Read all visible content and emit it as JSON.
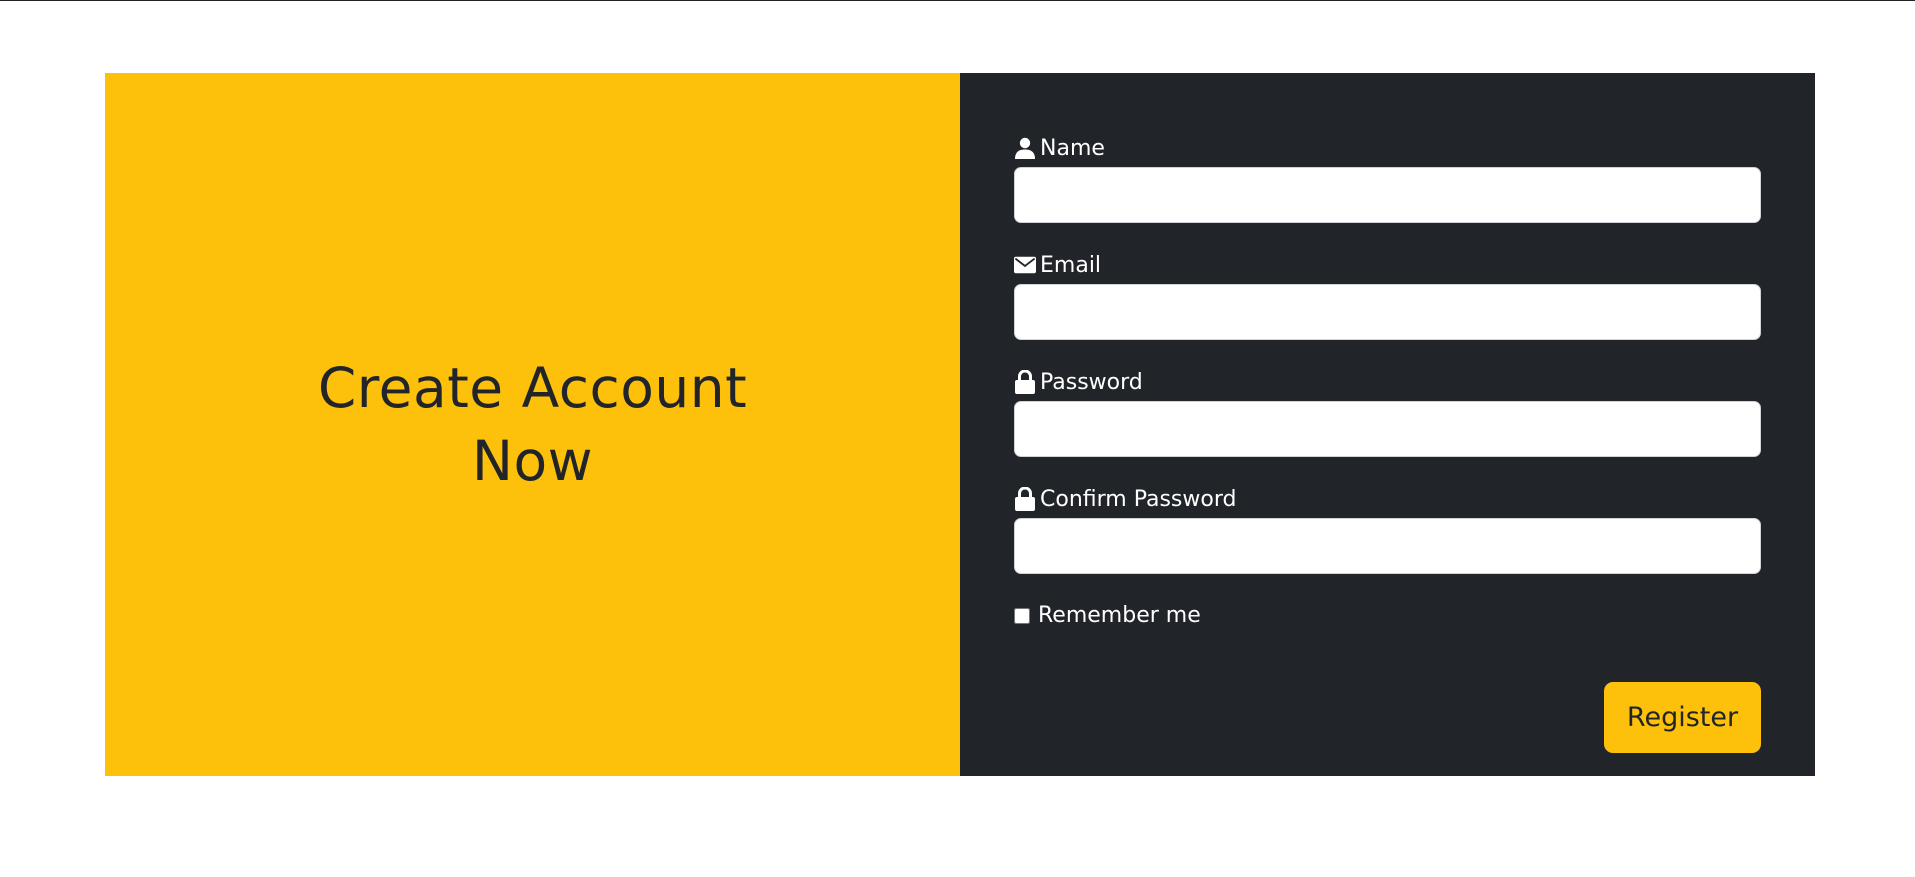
{
  "hero": {
    "title": "Create Account Now"
  },
  "form": {
    "fields": [
      {
        "label": "Name",
        "icon": "user-icon",
        "value": "",
        "placeholder": ""
      },
      {
        "label": "Email",
        "icon": "envelope-icon",
        "value": "",
        "placeholder": ""
      },
      {
        "label": "Password",
        "icon": "lock-icon",
        "value": "",
        "placeholder": ""
      },
      {
        "label": "Confirm Password",
        "icon": "lock-icon",
        "value": "",
        "placeholder": ""
      }
    ],
    "remember_label": "Remember me",
    "remember_checked": false,
    "submit_label": "Register"
  },
  "colors": {
    "accent": "#fdc00b",
    "panel_dark": "#212529",
    "text_dark": "#212529",
    "text_light": "#ffffff"
  }
}
